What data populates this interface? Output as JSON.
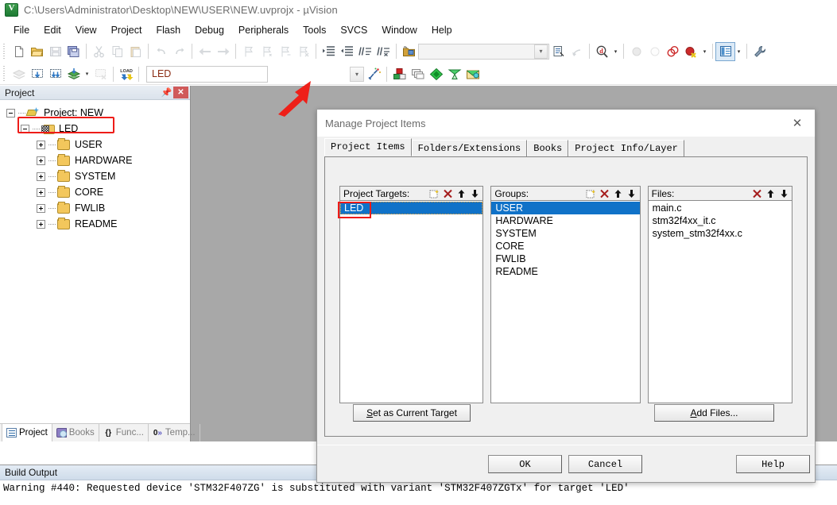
{
  "window": {
    "title": "C:\\Users\\Administrator\\Desktop\\NEW\\USER\\NEW.uvprojx - µVision",
    "app_icon": "uvision-logo-icon"
  },
  "menubar": {
    "items": [
      {
        "label": "File"
      },
      {
        "label": "Edit"
      },
      {
        "label": "View"
      },
      {
        "label": "Project"
      },
      {
        "label": "Flash"
      },
      {
        "label": "Debug"
      },
      {
        "label": "Peripherals"
      },
      {
        "label": "Tools"
      },
      {
        "label": "SVCS"
      },
      {
        "label": "Window"
      },
      {
        "label": "Help"
      }
    ]
  },
  "toolbar_main": {
    "buttons": [
      {
        "name": "new-file-icon"
      },
      {
        "name": "open-file-icon"
      },
      {
        "name": "save-icon"
      },
      {
        "name": "save-all-icon"
      },
      {
        "name": "cut-icon"
      },
      {
        "name": "copy-icon"
      },
      {
        "name": "paste-icon"
      },
      {
        "name": "undo-icon"
      },
      {
        "name": "redo-icon"
      },
      {
        "name": "navigate-back-icon"
      },
      {
        "name": "navigate-forward-icon"
      },
      {
        "name": "bookmark-toggle-icon"
      },
      {
        "name": "bookmark-prev-icon"
      },
      {
        "name": "bookmark-next-icon"
      },
      {
        "name": "bookmark-clear-icon"
      },
      {
        "name": "indent-right-icon"
      },
      {
        "name": "indent-left-icon"
      },
      {
        "name": "comment-icon"
      },
      {
        "name": "uncomment-icon"
      },
      {
        "name": "open-folder-icon"
      }
    ],
    "find_placeholder": "",
    "find_value": "",
    "extra_buttons": [
      {
        "name": "bookmark-list-icon"
      },
      {
        "name": "find-in-files-icon"
      },
      {
        "name": "debug-query-icon"
      },
      {
        "name": "breakpoint-icon"
      },
      {
        "name": "breakpoint-disable-icon"
      },
      {
        "name": "breakpoints-kill-icon"
      },
      {
        "name": "breakpoint-remove-icon"
      },
      {
        "name": "window-layout-icon"
      },
      {
        "name": "configure-icon"
      }
    ]
  },
  "toolbar_build": {
    "buttons": [
      {
        "name": "translate-icon"
      },
      {
        "name": "build-icon"
      },
      {
        "name": "rebuild-icon"
      },
      {
        "name": "batch-build-icon"
      },
      {
        "name": "stop-build-icon"
      },
      {
        "name": "download-icon"
      }
    ],
    "target_value": "LED",
    "right_buttons": [
      {
        "name": "target-options-icon"
      },
      {
        "name": "manage-project-items-icon"
      },
      {
        "name": "manage-multi-project-icon"
      },
      {
        "name": "pack-installer-icon"
      },
      {
        "name": "manage-rte-icon"
      },
      {
        "name": "pack-manage-icon"
      }
    ]
  },
  "project_panel": {
    "title": "Project",
    "pin_icon": "pin-icon",
    "close_icon": "close-icon",
    "tree": [
      {
        "label": "Project: NEW",
        "level": 0,
        "icon": "project-icon",
        "expander": "minus"
      },
      {
        "label": "LED",
        "level": 1,
        "icon": "target-icon",
        "expander": "minus",
        "highlighted": true
      },
      {
        "label": "USER",
        "level": 2,
        "icon": "folder-icon",
        "expander": "plus"
      },
      {
        "label": "HARDWARE",
        "level": 2,
        "icon": "folder-icon",
        "expander": "plus"
      },
      {
        "label": "SYSTEM",
        "level": 2,
        "icon": "folder-icon",
        "expander": "plus"
      },
      {
        "label": "CORE",
        "level": 2,
        "icon": "folder-icon",
        "expander": "plus"
      },
      {
        "label": "FWLIB",
        "level": 2,
        "icon": "folder-icon",
        "expander": "plus"
      },
      {
        "label": "README",
        "level": 2,
        "icon": "folder-icon",
        "expander": "plus"
      }
    ],
    "tabs": [
      {
        "label": "Project",
        "icon": "project-tab-icon",
        "active": true
      },
      {
        "label": "Books",
        "icon": "books-tab-icon",
        "active": false
      },
      {
        "label": "Func...",
        "icon": "functions-tab-icon",
        "active": false
      },
      {
        "label": "Temp...",
        "icon": "templates-tab-icon",
        "active": false
      }
    ]
  },
  "build_output": {
    "title": "Build Output",
    "lines": [
      "Warning #440: Requested device 'STM32F407ZG' is substituted with variant 'STM32F407ZGTx' for target 'LED'"
    ]
  },
  "dialog": {
    "title": "Manage Project Items",
    "close_icon": "close-icon",
    "tabs": [
      {
        "label": "Project Items",
        "active": true
      },
      {
        "label": "Folders/Extensions",
        "active": false
      },
      {
        "label": "Books",
        "active": false
      },
      {
        "label": "Project Info/Layer",
        "active": false
      }
    ],
    "columns": [
      {
        "header": "Project Targets:",
        "buttons": [
          "new-item-icon",
          "delete-icon",
          "move-up-icon",
          "move-down-icon"
        ],
        "items": [
          {
            "label": "LED",
            "selected": true,
            "highlighted": true
          }
        ]
      },
      {
        "header": "Groups:",
        "buttons": [
          "new-item-icon",
          "delete-icon",
          "move-up-icon",
          "move-down-icon"
        ],
        "items": [
          {
            "label": "USER",
            "selected": true
          },
          {
            "label": "HARDWARE",
            "selected": false
          },
          {
            "label": "SYSTEM",
            "selected": false
          },
          {
            "label": "CORE",
            "selected": false
          },
          {
            "label": "FWLIB",
            "selected": false
          },
          {
            "label": "README",
            "selected": false
          }
        ]
      },
      {
        "header": "Files:",
        "buttons": [
          "delete-icon",
          "move-up-icon",
          "move-down-icon"
        ],
        "items": [
          {
            "label": "main.c",
            "selected": false
          },
          {
            "label": "stm32f4xx_it.c",
            "selected": false
          },
          {
            "label": "system_stm32f4xx.c",
            "selected": false
          }
        ]
      }
    ],
    "set_target_button": {
      "prefix": "",
      "accel": "S",
      "suffix": "et as Current Target"
    },
    "add_files_button": {
      "prefix": "",
      "accel": "A",
      "suffix": "dd Files..."
    },
    "footer_buttons": [
      {
        "label": "OK",
        "name": "ok-button"
      },
      {
        "label": "Cancel",
        "name": "cancel-button"
      },
      {
        "label": "Help",
        "name": "help-button"
      }
    ]
  },
  "annotation": {
    "arrow_color": "#ee2019",
    "highlight_color": "#ee1c18"
  }
}
